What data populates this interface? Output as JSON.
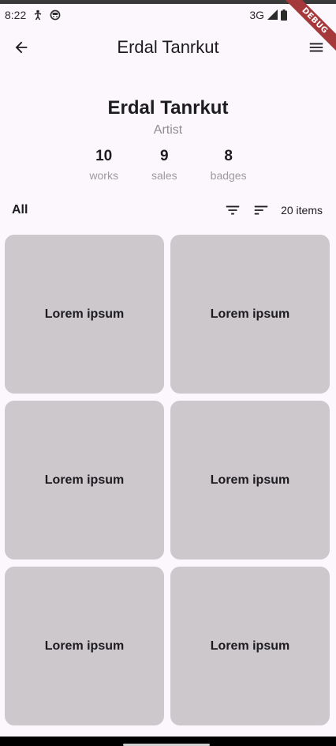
{
  "status_bar": {
    "time": "8:22",
    "network": "3G",
    "icons": [
      "accessibility-icon",
      "face-icon",
      "signal-icon",
      "battery-icon"
    ]
  },
  "debug_banner": "DEBUG",
  "app_bar": {
    "title": "Erdal Tanrkut",
    "back_icon": "arrow-back-icon",
    "menu_icon": "menu-icon"
  },
  "profile": {
    "name": "Erdal Tanrkut",
    "role": "Artist",
    "stats": [
      {
        "value": "10",
        "label": "works"
      },
      {
        "value": "9",
        "label": "sales"
      },
      {
        "value": "8",
        "label": "badges"
      }
    ]
  },
  "filter_bar": {
    "filter_label": "All",
    "filter_icon": "filter-icon",
    "sort_icon": "sort-icon",
    "items_count": "20 items"
  },
  "grid": {
    "cards": [
      {
        "label": "Lorem ipsum"
      },
      {
        "label": "Lorem ipsum"
      },
      {
        "label": "Lorem ipsum"
      },
      {
        "label": "Lorem ipsum"
      },
      {
        "label": "Lorem ipsum"
      },
      {
        "label": "Lorem ipsum"
      }
    ]
  },
  "colors": {
    "background": "#fcf7fd",
    "card": "#ccc8cc",
    "debug_ribbon": "#a5383a"
  }
}
